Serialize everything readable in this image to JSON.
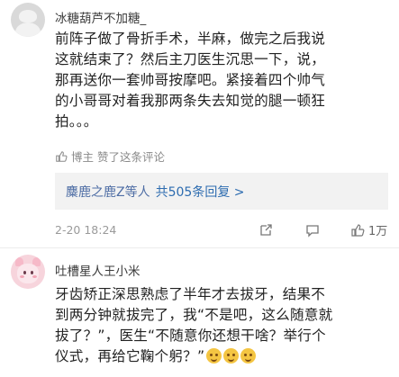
{
  "comments": [
    {
      "username": "冰糖葫芦不加糖_",
      "lines": [
        "前阵子做了骨折手术，半麻，做完之后我说",
        "这就结束了？然后主刀医生沉思一下，说，",
        "那再送你一套帅哥按摩吧。紧接着四个帅气",
        "的小哥哥对着我那两条失去知觉的腿一顿狂",
        "拍。。。"
      ],
      "author_liked": "博主 赞了这条评论",
      "replies_users": "麋鹿之鹿Z等人",
      "replies_count": "共505条回复 >",
      "time": "2-20 18:24",
      "likes": "1万"
    },
    {
      "username": "吐槽星人王小米",
      "lines": [
        "牙齿矫正深思熟虑了半年才去拔牙，结果不",
        "到两分钟就拔完了，我“不是吧，这么随意就",
        "拔了？”，医生“不随意你还想干啥？举行个",
        "仪式，再给它鞠个躬？”"
      ],
      "emoji_icons": [
        "laughing-emoji-icon",
        "laughing-emoji-icon",
        "laughing-emoji-icon"
      ]
    }
  ]
}
